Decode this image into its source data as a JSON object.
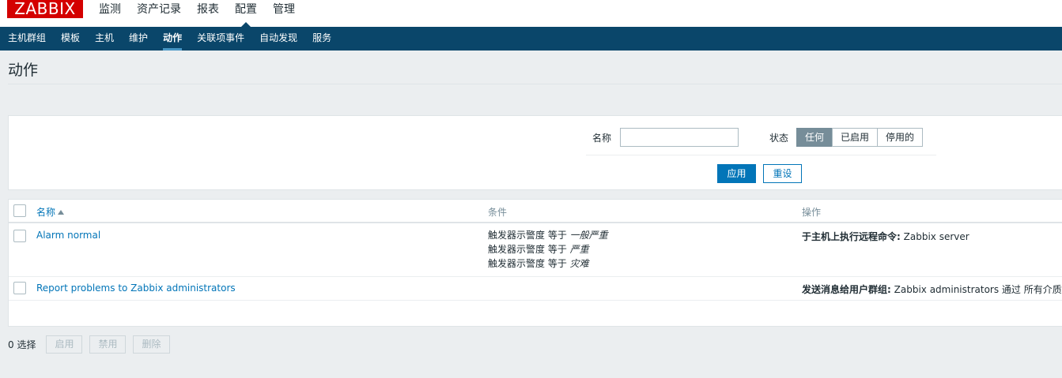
{
  "brand": {
    "logo": "ZABBIX"
  },
  "main_menu": [
    {
      "label": "监测"
    },
    {
      "label": "资产记录"
    },
    {
      "label": "报表"
    },
    {
      "label": "配置"
    },
    {
      "label": "管理"
    }
  ],
  "sub_nav": [
    {
      "label": "主机群组"
    },
    {
      "label": "模板"
    },
    {
      "label": "主机"
    },
    {
      "label": "维护"
    },
    {
      "label": "动作"
    },
    {
      "label": "关联项事件"
    },
    {
      "label": "自动发现"
    },
    {
      "label": "服务"
    }
  ],
  "page": {
    "title": "动作"
  },
  "filter": {
    "name_label": "名称",
    "name_value": "",
    "status_label": "状态",
    "status_options": [
      "任何",
      "已启用",
      "停用的"
    ],
    "status_selected": "任何",
    "apply_label": "应用",
    "reset_label": "重设"
  },
  "table": {
    "headers": {
      "name": "名称",
      "conditions": "条件",
      "operations": "操作"
    },
    "rows": [
      {
        "name": "Alarm normal",
        "conditions": [
          {
            "prefix": "触发器示警度 等于",
            "value": "一般严重"
          },
          {
            "prefix": "触发器示警度 等于",
            "value": "严重"
          },
          {
            "prefix": "触发器示警度 等于",
            "value": "灾难"
          }
        ],
        "operation_label": "于主机上执行远程命令:",
        "operation_value": "Zabbix server"
      },
      {
        "name": "Report problems to Zabbix administrators",
        "conditions": [],
        "operation_label": "发送消息给用户群组:",
        "operation_value": "Zabbix administrators 通过 所有介质"
      }
    ]
  },
  "footer": {
    "selected_count": "0 选择",
    "enable_label": "启用",
    "disable_label": "禁用",
    "delete_label": "删除"
  },
  "colors": {
    "brand_red": "#d40000",
    "nav_bg": "#0a466a",
    "link_blue": "#0275b8",
    "selected_segment": "#768d99"
  }
}
